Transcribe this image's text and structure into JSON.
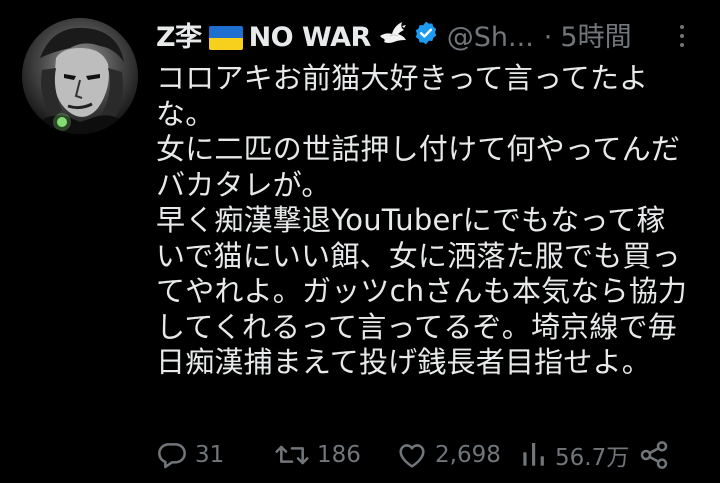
{
  "tweet": {
    "author": {
      "display_name": "Z李",
      "suffix": "NO WAR",
      "handle": "@Sh...",
      "verified": true
    },
    "separator": "·",
    "timestamp": "5時間",
    "lines": [
      "コロアキお前猫大好きって言ってたよ",
      "な。",
      "女に二匹の世話押し付けて何やってんだ",
      "バカタレが。",
      "早く痴漢撃退YouTuberにでもなって稼",
      "いで猫にいい餌、女に洒落た服でも買っ",
      "てやれよ。ガッツchさんも本気なら協力",
      "してくれるって言ってるぞ。埼京線で毎",
      "日痴漢捕まえて投げ銭長者目指せよ。"
    ],
    "stats": {
      "replies": "31",
      "retweets": "186",
      "likes": "2,698",
      "views": "56.7万"
    },
    "icons": {
      "flag": "ukraine-flag-icon",
      "dove": "dove-icon",
      "verified": "verified-badge-icon",
      "more": "more-icon",
      "reply": "reply-icon",
      "retweet": "retweet-icon",
      "like": "like-icon",
      "views": "views-icon",
      "share": "share-icon"
    },
    "colors": {
      "background": "#000000",
      "text": "#e7e9ea",
      "muted": "#71767b",
      "verified": "#1d9bf0",
      "flag_blue": "#1f6fd1",
      "flag_yellow": "#f7cf1d"
    }
  }
}
